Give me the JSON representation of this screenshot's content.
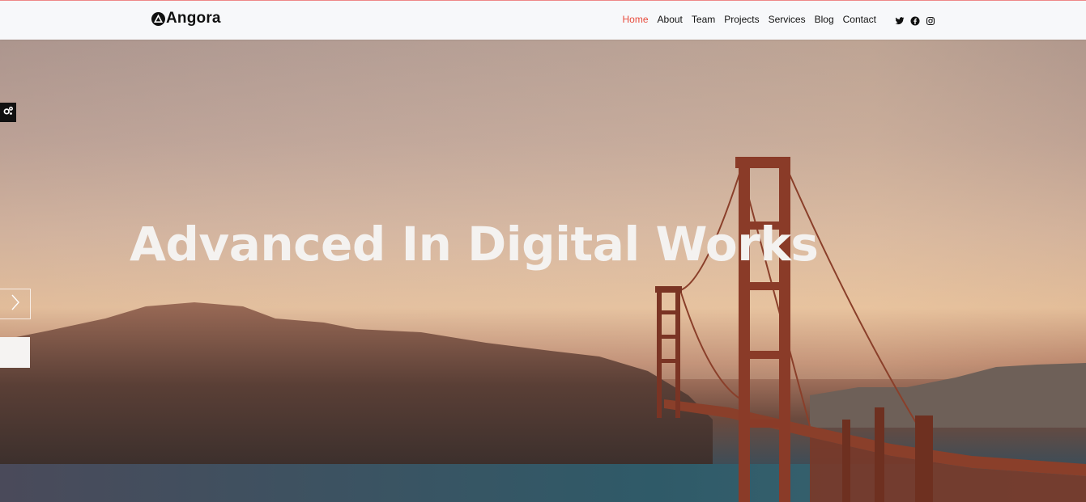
{
  "brand": {
    "name": "Angora",
    "icon": "angora-logo-icon"
  },
  "nav": {
    "items": [
      {
        "label": "Home",
        "active": true
      },
      {
        "label": "About",
        "active": false
      },
      {
        "label": "Team",
        "active": false
      },
      {
        "label": "Projects",
        "active": false
      },
      {
        "label": "Services",
        "active": false
      },
      {
        "label": "Blog",
        "active": false
      },
      {
        "label": "Contact",
        "active": false
      }
    ],
    "social": [
      "twitter-icon",
      "facebook-icon",
      "instagram-icon"
    ]
  },
  "hero": {
    "title": "Advanced In Digital Works",
    "background": "golden-gate-bridge-sunset-photo"
  },
  "controls": {
    "settings_icon": "gears-icon",
    "next_icon": "chevron-right-icon"
  },
  "colors": {
    "accent": "#e84c3d",
    "nav_bg": "#f7f8fa",
    "text": "#111111"
  }
}
